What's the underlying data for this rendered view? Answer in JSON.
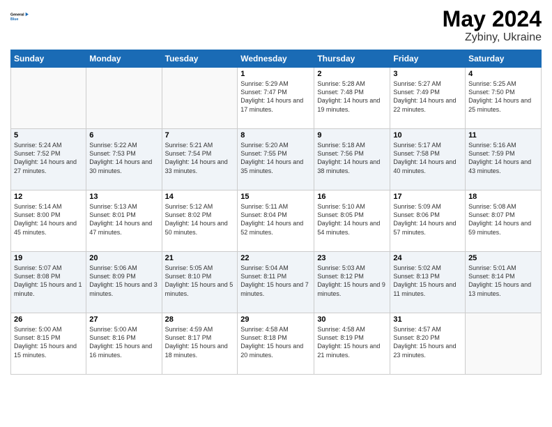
{
  "logo": {
    "text_general": "General",
    "text_blue": "Blue"
  },
  "header": {
    "month_year": "May 2024",
    "location": "Zybiny, Ukraine"
  },
  "days_of_week": [
    "Sunday",
    "Monday",
    "Tuesday",
    "Wednesday",
    "Thursday",
    "Friday",
    "Saturday"
  ],
  "weeks": [
    [
      {
        "day": "",
        "sunrise": "",
        "sunset": "",
        "daylight": ""
      },
      {
        "day": "",
        "sunrise": "",
        "sunset": "",
        "daylight": ""
      },
      {
        "day": "",
        "sunrise": "",
        "sunset": "",
        "daylight": ""
      },
      {
        "day": "1",
        "sunrise": "Sunrise: 5:29 AM",
        "sunset": "Sunset: 7:47 PM",
        "daylight": "Daylight: 14 hours and 17 minutes."
      },
      {
        "day": "2",
        "sunrise": "Sunrise: 5:28 AM",
        "sunset": "Sunset: 7:48 PM",
        "daylight": "Daylight: 14 hours and 19 minutes."
      },
      {
        "day": "3",
        "sunrise": "Sunrise: 5:27 AM",
        "sunset": "Sunset: 7:49 PM",
        "daylight": "Daylight: 14 hours and 22 minutes."
      },
      {
        "day": "4",
        "sunrise": "Sunrise: 5:25 AM",
        "sunset": "Sunset: 7:50 PM",
        "daylight": "Daylight: 14 hours and 25 minutes."
      }
    ],
    [
      {
        "day": "5",
        "sunrise": "Sunrise: 5:24 AM",
        "sunset": "Sunset: 7:52 PM",
        "daylight": "Daylight: 14 hours and 27 minutes."
      },
      {
        "day": "6",
        "sunrise": "Sunrise: 5:22 AM",
        "sunset": "Sunset: 7:53 PM",
        "daylight": "Daylight: 14 hours and 30 minutes."
      },
      {
        "day": "7",
        "sunrise": "Sunrise: 5:21 AM",
        "sunset": "Sunset: 7:54 PM",
        "daylight": "Daylight: 14 hours and 33 minutes."
      },
      {
        "day": "8",
        "sunrise": "Sunrise: 5:20 AM",
        "sunset": "Sunset: 7:55 PM",
        "daylight": "Daylight: 14 hours and 35 minutes."
      },
      {
        "day": "9",
        "sunrise": "Sunrise: 5:18 AM",
        "sunset": "Sunset: 7:56 PM",
        "daylight": "Daylight: 14 hours and 38 minutes."
      },
      {
        "day": "10",
        "sunrise": "Sunrise: 5:17 AM",
        "sunset": "Sunset: 7:58 PM",
        "daylight": "Daylight: 14 hours and 40 minutes."
      },
      {
        "day": "11",
        "sunrise": "Sunrise: 5:16 AM",
        "sunset": "Sunset: 7:59 PM",
        "daylight": "Daylight: 14 hours and 43 minutes."
      }
    ],
    [
      {
        "day": "12",
        "sunrise": "Sunrise: 5:14 AM",
        "sunset": "Sunset: 8:00 PM",
        "daylight": "Daylight: 14 hours and 45 minutes."
      },
      {
        "day": "13",
        "sunrise": "Sunrise: 5:13 AM",
        "sunset": "Sunset: 8:01 PM",
        "daylight": "Daylight: 14 hours and 47 minutes."
      },
      {
        "day": "14",
        "sunrise": "Sunrise: 5:12 AM",
        "sunset": "Sunset: 8:02 PM",
        "daylight": "Daylight: 14 hours and 50 minutes."
      },
      {
        "day": "15",
        "sunrise": "Sunrise: 5:11 AM",
        "sunset": "Sunset: 8:04 PM",
        "daylight": "Daylight: 14 hours and 52 minutes."
      },
      {
        "day": "16",
        "sunrise": "Sunrise: 5:10 AM",
        "sunset": "Sunset: 8:05 PM",
        "daylight": "Daylight: 14 hours and 54 minutes."
      },
      {
        "day": "17",
        "sunrise": "Sunrise: 5:09 AM",
        "sunset": "Sunset: 8:06 PM",
        "daylight": "Daylight: 14 hours and 57 minutes."
      },
      {
        "day": "18",
        "sunrise": "Sunrise: 5:08 AM",
        "sunset": "Sunset: 8:07 PM",
        "daylight": "Daylight: 14 hours and 59 minutes."
      }
    ],
    [
      {
        "day": "19",
        "sunrise": "Sunrise: 5:07 AM",
        "sunset": "Sunset: 8:08 PM",
        "daylight": "Daylight: 15 hours and 1 minute."
      },
      {
        "day": "20",
        "sunrise": "Sunrise: 5:06 AM",
        "sunset": "Sunset: 8:09 PM",
        "daylight": "Daylight: 15 hours and 3 minutes."
      },
      {
        "day": "21",
        "sunrise": "Sunrise: 5:05 AM",
        "sunset": "Sunset: 8:10 PM",
        "daylight": "Daylight: 15 hours and 5 minutes."
      },
      {
        "day": "22",
        "sunrise": "Sunrise: 5:04 AM",
        "sunset": "Sunset: 8:11 PM",
        "daylight": "Daylight: 15 hours and 7 minutes."
      },
      {
        "day": "23",
        "sunrise": "Sunrise: 5:03 AM",
        "sunset": "Sunset: 8:12 PM",
        "daylight": "Daylight: 15 hours and 9 minutes."
      },
      {
        "day": "24",
        "sunrise": "Sunrise: 5:02 AM",
        "sunset": "Sunset: 8:13 PM",
        "daylight": "Daylight: 15 hours and 11 minutes."
      },
      {
        "day": "25",
        "sunrise": "Sunrise: 5:01 AM",
        "sunset": "Sunset: 8:14 PM",
        "daylight": "Daylight: 15 hours and 13 minutes."
      }
    ],
    [
      {
        "day": "26",
        "sunrise": "Sunrise: 5:00 AM",
        "sunset": "Sunset: 8:15 PM",
        "daylight": "Daylight: 15 hours and 15 minutes."
      },
      {
        "day": "27",
        "sunrise": "Sunrise: 5:00 AM",
        "sunset": "Sunset: 8:16 PM",
        "daylight": "Daylight: 15 hours and 16 minutes."
      },
      {
        "day": "28",
        "sunrise": "Sunrise: 4:59 AM",
        "sunset": "Sunset: 8:17 PM",
        "daylight": "Daylight: 15 hours and 18 minutes."
      },
      {
        "day": "29",
        "sunrise": "Sunrise: 4:58 AM",
        "sunset": "Sunset: 8:18 PM",
        "daylight": "Daylight: 15 hours and 20 minutes."
      },
      {
        "day": "30",
        "sunrise": "Sunrise: 4:58 AM",
        "sunset": "Sunset: 8:19 PM",
        "daylight": "Daylight: 15 hours and 21 minutes."
      },
      {
        "day": "31",
        "sunrise": "Sunrise: 4:57 AM",
        "sunset": "Sunset: 8:20 PM",
        "daylight": "Daylight: 15 hours and 23 minutes."
      },
      {
        "day": "",
        "sunrise": "",
        "sunset": "",
        "daylight": ""
      }
    ]
  ]
}
